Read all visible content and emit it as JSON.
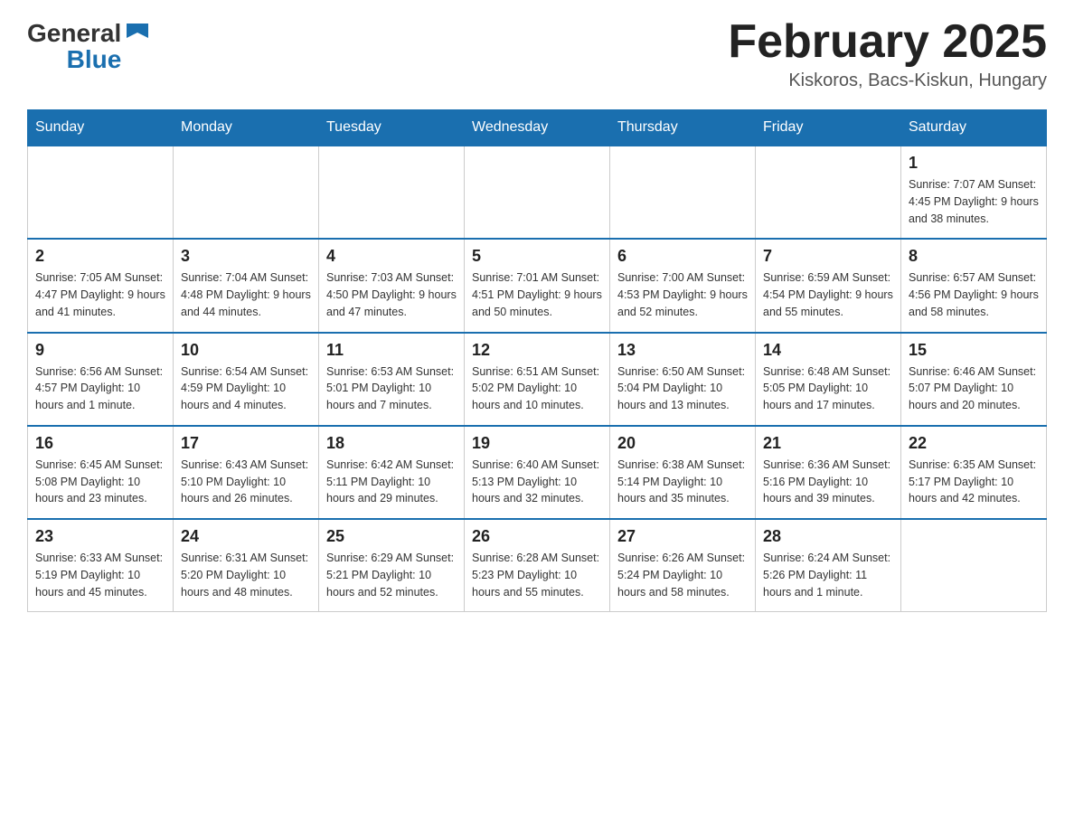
{
  "header": {
    "logo_general": "General",
    "logo_blue": "Blue",
    "month_title": "February 2025",
    "location": "Kiskoros, Bacs-Kiskun, Hungary"
  },
  "weekdays": [
    "Sunday",
    "Monday",
    "Tuesday",
    "Wednesday",
    "Thursday",
    "Friday",
    "Saturday"
  ],
  "weeks": [
    {
      "days": [
        {
          "num": "",
          "info": ""
        },
        {
          "num": "",
          "info": ""
        },
        {
          "num": "",
          "info": ""
        },
        {
          "num": "",
          "info": ""
        },
        {
          "num": "",
          "info": ""
        },
        {
          "num": "",
          "info": ""
        },
        {
          "num": "1",
          "info": "Sunrise: 7:07 AM\nSunset: 4:45 PM\nDaylight: 9 hours and 38 minutes."
        }
      ]
    },
    {
      "days": [
        {
          "num": "2",
          "info": "Sunrise: 7:05 AM\nSunset: 4:47 PM\nDaylight: 9 hours and 41 minutes."
        },
        {
          "num": "3",
          "info": "Sunrise: 7:04 AM\nSunset: 4:48 PM\nDaylight: 9 hours and 44 minutes."
        },
        {
          "num": "4",
          "info": "Sunrise: 7:03 AM\nSunset: 4:50 PM\nDaylight: 9 hours and 47 minutes."
        },
        {
          "num": "5",
          "info": "Sunrise: 7:01 AM\nSunset: 4:51 PM\nDaylight: 9 hours and 50 minutes."
        },
        {
          "num": "6",
          "info": "Sunrise: 7:00 AM\nSunset: 4:53 PM\nDaylight: 9 hours and 52 minutes."
        },
        {
          "num": "7",
          "info": "Sunrise: 6:59 AM\nSunset: 4:54 PM\nDaylight: 9 hours and 55 minutes."
        },
        {
          "num": "8",
          "info": "Sunrise: 6:57 AM\nSunset: 4:56 PM\nDaylight: 9 hours and 58 minutes."
        }
      ]
    },
    {
      "days": [
        {
          "num": "9",
          "info": "Sunrise: 6:56 AM\nSunset: 4:57 PM\nDaylight: 10 hours and 1 minute."
        },
        {
          "num": "10",
          "info": "Sunrise: 6:54 AM\nSunset: 4:59 PM\nDaylight: 10 hours and 4 minutes."
        },
        {
          "num": "11",
          "info": "Sunrise: 6:53 AM\nSunset: 5:01 PM\nDaylight: 10 hours and 7 minutes."
        },
        {
          "num": "12",
          "info": "Sunrise: 6:51 AM\nSunset: 5:02 PM\nDaylight: 10 hours and 10 minutes."
        },
        {
          "num": "13",
          "info": "Sunrise: 6:50 AM\nSunset: 5:04 PM\nDaylight: 10 hours and 13 minutes."
        },
        {
          "num": "14",
          "info": "Sunrise: 6:48 AM\nSunset: 5:05 PM\nDaylight: 10 hours and 17 minutes."
        },
        {
          "num": "15",
          "info": "Sunrise: 6:46 AM\nSunset: 5:07 PM\nDaylight: 10 hours and 20 minutes."
        }
      ]
    },
    {
      "days": [
        {
          "num": "16",
          "info": "Sunrise: 6:45 AM\nSunset: 5:08 PM\nDaylight: 10 hours and 23 minutes."
        },
        {
          "num": "17",
          "info": "Sunrise: 6:43 AM\nSunset: 5:10 PM\nDaylight: 10 hours and 26 minutes."
        },
        {
          "num": "18",
          "info": "Sunrise: 6:42 AM\nSunset: 5:11 PM\nDaylight: 10 hours and 29 minutes."
        },
        {
          "num": "19",
          "info": "Sunrise: 6:40 AM\nSunset: 5:13 PM\nDaylight: 10 hours and 32 minutes."
        },
        {
          "num": "20",
          "info": "Sunrise: 6:38 AM\nSunset: 5:14 PM\nDaylight: 10 hours and 35 minutes."
        },
        {
          "num": "21",
          "info": "Sunrise: 6:36 AM\nSunset: 5:16 PM\nDaylight: 10 hours and 39 minutes."
        },
        {
          "num": "22",
          "info": "Sunrise: 6:35 AM\nSunset: 5:17 PM\nDaylight: 10 hours and 42 minutes."
        }
      ]
    },
    {
      "days": [
        {
          "num": "23",
          "info": "Sunrise: 6:33 AM\nSunset: 5:19 PM\nDaylight: 10 hours and 45 minutes."
        },
        {
          "num": "24",
          "info": "Sunrise: 6:31 AM\nSunset: 5:20 PM\nDaylight: 10 hours and 48 minutes."
        },
        {
          "num": "25",
          "info": "Sunrise: 6:29 AM\nSunset: 5:21 PM\nDaylight: 10 hours and 52 minutes."
        },
        {
          "num": "26",
          "info": "Sunrise: 6:28 AM\nSunset: 5:23 PM\nDaylight: 10 hours and 55 minutes."
        },
        {
          "num": "27",
          "info": "Sunrise: 6:26 AM\nSunset: 5:24 PM\nDaylight: 10 hours and 58 minutes."
        },
        {
          "num": "28",
          "info": "Sunrise: 6:24 AM\nSunset: 5:26 PM\nDaylight: 11 hours and 1 minute."
        },
        {
          "num": "",
          "info": ""
        }
      ]
    }
  ]
}
